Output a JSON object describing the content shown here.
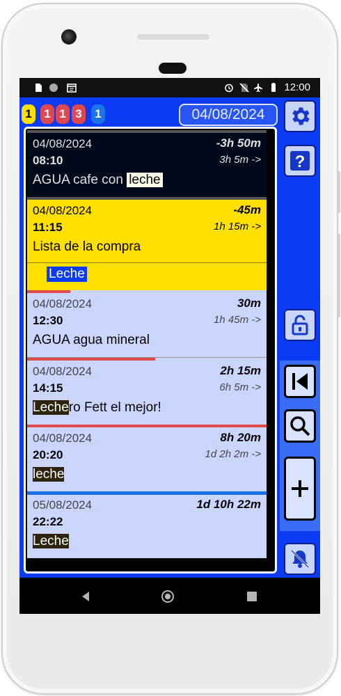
{
  "status_bar": {
    "time": "12:00",
    "icons": [
      "sd-card-icon",
      "circle-icon",
      "calendar-icon",
      "alarm-icon",
      "no-sim-icon",
      "airplane-icon",
      "battery-icon"
    ]
  },
  "header": {
    "badges": [
      {
        "value": "1",
        "color": "#ffe000"
      },
      {
        "value": "1",
        "color": "#e0484f"
      },
      {
        "value": "1",
        "color": "#e0484f"
      },
      {
        "value": "3",
        "color": "#e0484f"
      },
      {
        "value": "1",
        "color": "#1a73e8"
      }
    ],
    "date": "04/08/2024"
  },
  "side_buttons": [
    "settings",
    "help",
    "unlock",
    "first-page",
    "search",
    "add",
    "notifications-off"
  ],
  "entries": [
    {
      "date": "04/08/2024",
      "time": "08:10",
      "duration": "-3h 50m",
      "subtext": "3h 5m ->",
      "title_plain": "AGUA cafe con ",
      "title_highlight": "leche",
      "bg": "#000a1a",
      "text_color": "#e0e0e0"
    },
    {
      "date": "04/08/2024",
      "time": "11:15",
      "duration": "-45m",
      "subtext": "1h 15m ->",
      "title": "Lista de la compra",
      "extra_line": "Leche",
      "bg": "#ffe000"
    },
    {
      "date": "04/08/2024",
      "time": "12:30",
      "duration": "30m",
      "subtext": "1h 45m ->",
      "title": "AGUA agua mineral",
      "bg": "#cbd6ff"
    },
    {
      "date": "04/08/2024",
      "time": "14:15",
      "duration": "2h 15m",
      "subtext": "6h 5m ->",
      "title_highlight": "Leche",
      "title_rest": "ro Fett el mejor!",
      "bg": "#cbd6ff"
    },
    {
      "date": "04/08/2024",
      "time": "20:20",
      "duration": "8h 20m",
      "subtext": "1d 2h 2m ->",
      "title_highlight": "leche",
      "bg": "#cbd6ff"
    },
    {
      "date": "05/08/2024",
      "time": "22:22",
      "duration": "1d 10h 22m",
      "subtext": "",
      "title_highlight": "Leche",
      "bg": "#cbd6ff"
    }
  ],
  "navbar": [
    "back-icon",
    "home-icon",
    "recents-icon"
  ]
}
